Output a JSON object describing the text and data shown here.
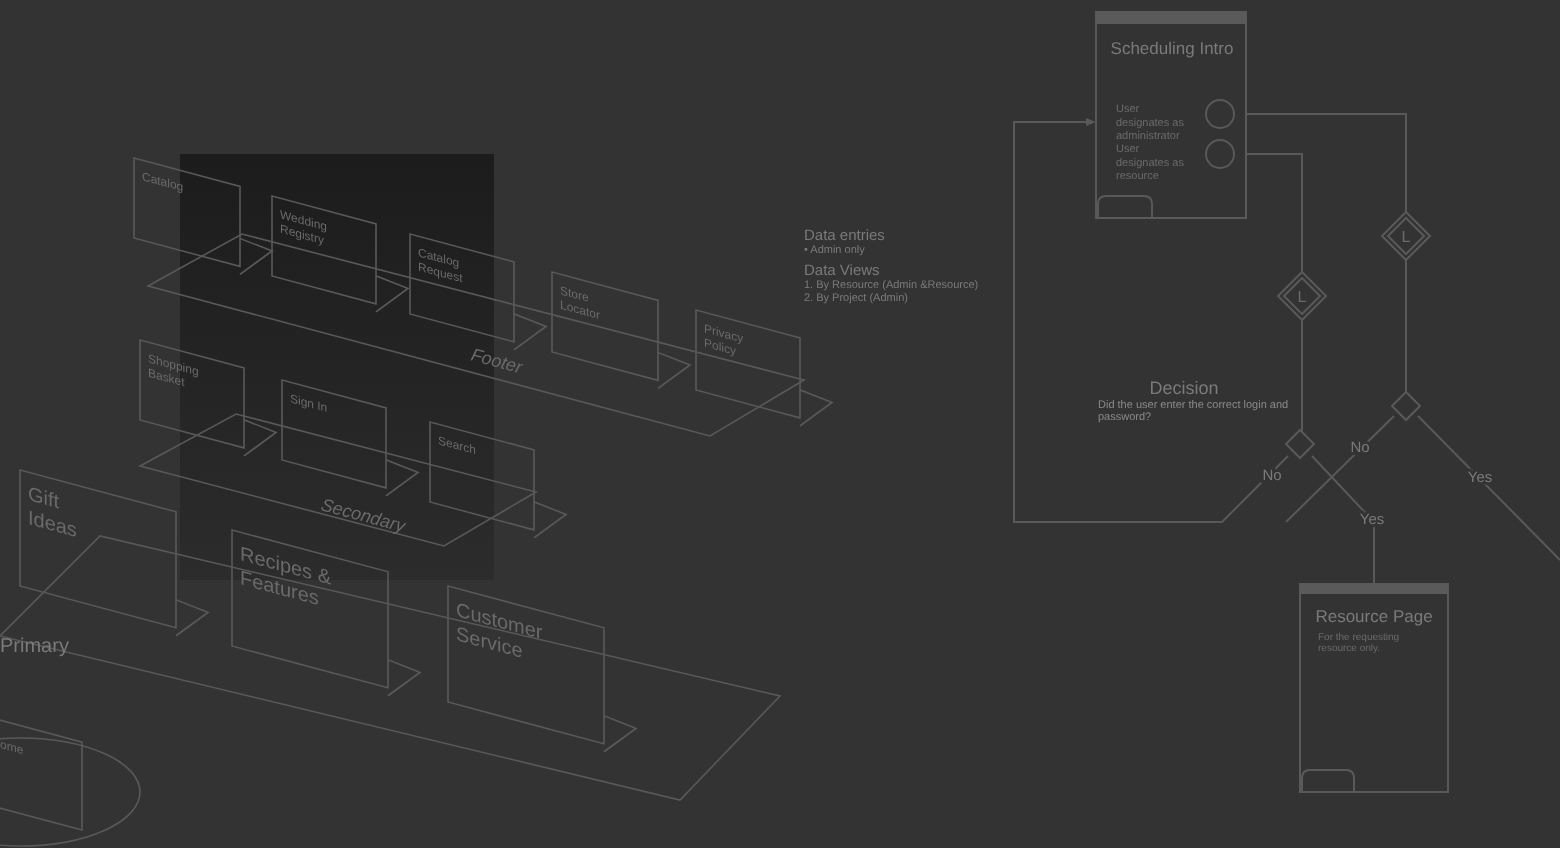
{
  "sitemap": {
    "tiers": [
      {
        "label": "Footer",
        "pages": [
          "Catalog",
          "Wedding Registry",
          "Catalog Request",
          "Store Locator",
          "Privacy Policy"
        ]
      },
      {
        "label": "Secondary",
        "pages": [
          "Shopping Basket",
          "Sign In",
          "Search"
        ]
      },
      {
        "label": "Primary",
        "pages": [
          "Gift Ideas",
          "Recipes & Features",
          "Customer Service"
        ]
      }
    ],
    "home": "ome"
  },
  "notes": [
    {
      "heading": "Data entries",
      "items": [
        "• Admin only"
      ]
    },
    {
      "heading": "Data Views",
      "items": [
        "1. By Resource (Admin &Resource)",
        "2. By Project (Admin)"
      ]
    }
  ],
  "flow": {
    "intro": {
      "title": "Scheduling Intro",
      "options": [
        "User designates as administrator",
        "User designates as resource"
      ]
    },
    "gates": [
      "L",
      "L"
    ],
    "decision": {
      "title": "Decision",
      "question": "Did the user enter the correct login and password?"
    },
    "branches": [
      {
        "no": "No",
        "yes": "Yes"
      },
      {
        "no": "No",
        "yes": "Yes"
      }
    ],
    "resource_page": {
      "title": "Resource Page",
      "note": "For the requesting resource only."
    }
  }
}
